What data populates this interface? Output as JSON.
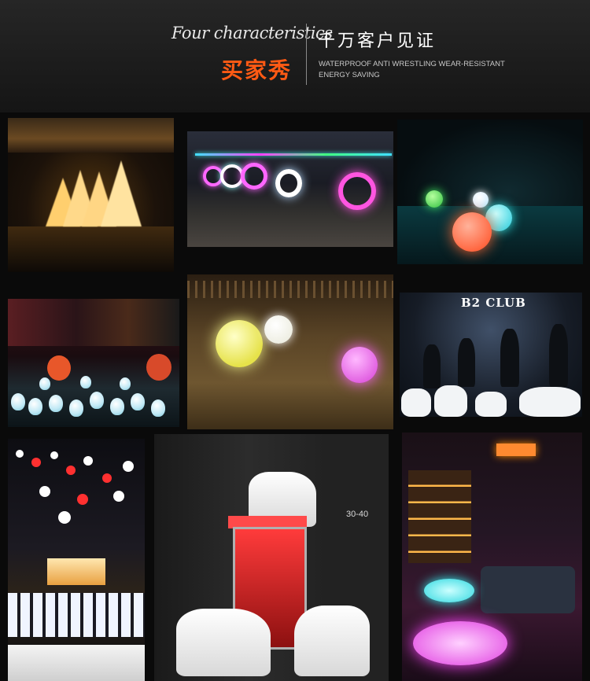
{
  "header": {
    "script_title": "Four characteristics",
    "cn_orange": "买家秀",
    "cn_title": "千万客户见证",
    "features_line1": "WATERPROOF  ANTI WRESTLING  WEAR-RESISTANT",
    "features_line2": "ENERGY SAVING"
  },
  "photos": {
    "club_sign": "B2 CLUB",
    "floor_sign": "30-40"
  },
  "colors": {
    "accent": "#ff5a14",
    "header_bg": "#1e1e1e",
    "page_bg": "#0a0a0a"
  }
}
